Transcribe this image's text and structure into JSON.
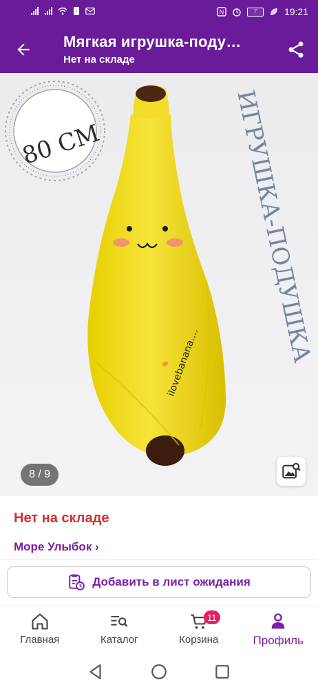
{
  "status_bar": {
    "battery": "7",
    "time": "19:21",
    "icons": [
      "signal-icon",
      "signal-icon",
      "wifi-icon",
      "sim-icon",
      "mail-icon",
      "nfc-icon",
      "alarm-icon",
      "battery-icon"
    ]
  },
  "header": {
    "title": "Мягкая игрушка-поду…",
    "subtitle": "Нет на складе",
    "icons": [
      "back-arrow-icon",
      "share-icon"
    ]
  },
  "gallery": {
    "size_badge": "80 СМ",
    "vertical_caption": "ИГРУШКА-ПОДУШКА",
    "toy_print": "ilovebanana....",
    "page_indicator": "8 / 9",
    "icons": [
      "image-search-icon"
    ]
  },
  "product": {
    "stock_status": "Нет на складе",
    "brand_link": "Море Улыбок ›"
  },
  "waitlist": {
    "label": "Добавить в лист ожидания",
    "icon": "clipboard-clock-icon"
  },
  "bottom_nav": {
    "items": [
      {
        "label": "Главная",
        "icon": "home-icon"
      },
      {
        "label": "Каталог",
        "icon": "catalog-search-icon"
      },
      {
        "label": "Корзина",
        "icon": "cart-icon",
        "badge": "11"
      },
      {
        "label": "Профиль",
        "icon": "profile-icon",
        "active": true
      }
    ]
  },
  "system_nav": {
    "icons": [
      "back-triangle-icon",
      "home-circle-icon",
      "recents-square-icon"
    ]
  },
  "colors": {
    "primary": "#6a1b9a",
    "accent": "#7b1fa2",
    "error": "#d32f2f",
    "badge": "#e91e63"
  }
}
